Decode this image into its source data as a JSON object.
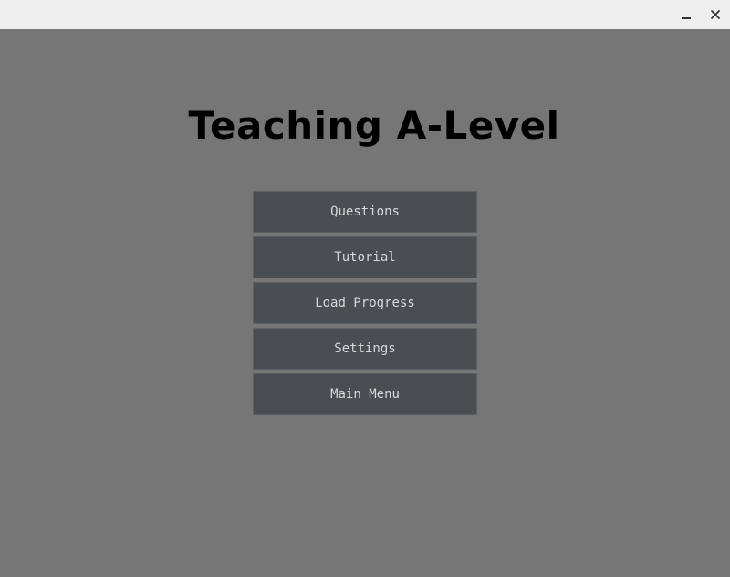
{
  "window": {
    "minimize_icon": "minimize-icon",
    "close_icon": "close-icon"
  },
  "app": {
    "title": "Teaching A-Level"
  },
  "menu": {
    "items": [
      {
        "label": "Questions"
      },
      {
        "label": "Tutorial"
      },
      {
        "label": "Load Progress"
      },
      {
        "label": "Settings"
      },
      {
        "label": "Main Menu"
      }
    ]
  },
  "colors": {
    "background": "#767676",
    "titlebar": "#efefef",
    "button": "#4a4d51",
    "button_text": "#d8d8d8",
    "title_text": "#000000"
  }
}
